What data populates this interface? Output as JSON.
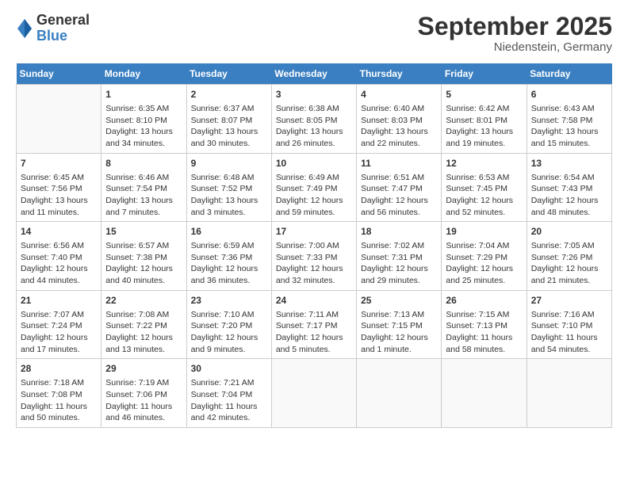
{
  "logo": {
    "general": "General",
    "blue": "Blue"
  },
  "title": "September 2025",
  "location": "Niedenstein, Germany",
  "weekdays": [
    "Sunday",
    "Monday",
    "Tuesday",
    "Wednesday",
    "Thursday",
    "Friday",
    "Saturday"
  ],
  "weeks": [
    [
      {
        "day": "",
        "info": ""
      },
      {
        "day": "1",
        "info": "Sunrise: 6:35 AM\nSunset: 8:10 PM\nDaylight: 13 hours\nand 34 minutes."
      },
      {
        "day": "2",
        "info": "Sunrise: 6:37 AM\nSunset: 8:07 PM\nDaylight: 13 hours\nand 30 minutes."
      },
      {
        "day": "3",
        "info": "Sunrise: 6:38 AM\nSunset: 8:05 PM\nDaylight: 13 hours\nand 26 minutes."
      },
      {
        "day": "4",
        "info": "Sunrise: 6:40 AM\nSunset: 8:03 PM\nDaylight: 13 hours\nand 22 minutes."
      },
      {
        "day": "5",
        "info": "Sunrise: 6:42 AM\nSunset: 8:01 PM\nDaylight: 13 hours\nand 19 minutes."
      },
      {
        "day": "6",
        "info": "Sunrise: 6:43 AM\nSunset: 7:58 PM\nDaylight: 13 hours\nand 15 minutes."
      }
    ],
    [
      {
        "day": "7",
        "info": "Sunrise: 6:45 AM\nSunset: 7:56 PM\nDaylight: 13 hours\nand 11 minutes."
      },
      {
        "day": "8",
        "info": "Sunrise: 6:46 AM\nSunset: 7:54 PM\nDaylight: 13 hours\nand 7 minutes."
      },
      {
        "day": "9",
        "info": "Sunrise: 6:48 AM\nSunset: 7:52 PM\nDaylight: 13 hours\nand 3 minutes."
      },
      {
        "day": "10",
        "info": "Sunrise: 6:49 AM\nSunset: 7:49 PM\nDaylight: 12 hours\nand 59 minutes."
      },
      {
        "day": "11",
        "info": "Sunrise: 6:51 AM\nSunset: 7:47 PM\nDaylight: 12 hours\nand 56 minutes."
      },
      {
        "day": "12",
        "info": "Sunrise: 6:53 AM\nSunset: 7:45 PM\nDaylight: 12 hours\nand 52 minutes."
      },
      {
        "day": "13",
        "info": "Sunrise: 6:54 AM\nSunset: 7:43 PM\nDaylight: 12 hours\nand 48 minutes."
      }
    ],
    [
      {
        "day": "14",
        "info": "Sunrise: 6:56 AM\nSunset: 7:40 PM\nDaylight: 12 hours\nand 44 minutes."
      },
      {
        "day": "15",
        "info": "Sunrise: 6:57 AM\nSunset: 7:38 PM\nDaylight: 12 hours\nand 40 minutes."
      },
      {
        "day": "16",
        "info": "Sunrise: 6:59 AM\nSunset: 7:36 PM\nDaylight: 12 hours\nand 36 minutes."
      },
      {
        "day": "17",
        "info": "Sunrise: 7:00 AM\nSunset: 7:33 PM\nDaylight: 12 hours\nand 32 minutes."
      },
      {
        "day": "18",
        "info": "Sunrise: 7:02 AM\nSunset: 7:31 PM\nDaylight: 12 hours\nand 29 minutes."
      },
      {
        "day": "19",
        "info": "Sunrise: 7:04 AM\nSunset: 7:29 PM\nDaylight: 12 hours\nand 25 minutes."
      },
      {
        "day": "20",
        "info": "Sunrise: 7:05 AM\nSunset: 7:26 PM\nDaylight: 12 hours\nand 21 minutes."
      }
    ],
    [
      {
        "day": "21",
        "info": "Sunrise: 7:07 AM\nSunset: 7:24 PM\nDaylight: 12 hours\nand 17 minutes."
      },
      {
        "day": "22",
        "info": "Sunrise: 7:08 AM\nSunset: 7:22 PM\nDaylight: 12 hours\nand 13 minutes."
      },
      {
        "day": "23",
        "info": "Sunrise: 7:10 AM\nSunset: 7:20 PM\nDaylight: 12 hours\nand 9 minutes."
      },
      {
        "day": "24",
        "info": "Sunrise: 7:11 AM\nSunset: 7:17 PM\nDaylight: 12 hours\nand 5 minutes."
      },
      {
        "day": "25",
        "info": "Sunrise: 7:13 AM\nSunset: 7:15 PM\nDaylight: 12 hours\nand 1 minute."
      },
      {
        "day": "26",
        "info": "Sunrise: 7:15 AM\nSunset: 7:13 PM\nDaylight: 11 hours\nand 58 minutes."
      },
      {
        "day": "27",
        "info": "Sunrise: 7:16 AM\nSunset: 7:10 PM\nDaylight: 11 hours\nand 54 minutes."
      }
    ],
    [
      {
        "day": "28",
        "info": "Sunrise: 7:18 AM\nSunset: 7:08 PM\nDaylight: 11 hours\nand 50 minutes."
      },
      {
        "day": "29",
        "info": "Sunrise: 7:19 AM\nSunset: 7:06 PM\nDaylight: 11 hours\nand 46 minutes."
      },
      {
        "day": "30",
        "info": "Sunrise: 7:21 AM\nSunset: 7:04 PM\nDaylight: 11 hours\nand 42 minutes."
      },
      {
        "day": "",
        "info": ""
      },
      {
        "day": "",
        "info": ""
      },
      {
        "day": "",
        "info": ""
      },
      {
        "day": "",
        "info": ""
      }
    ]
  ]
}
